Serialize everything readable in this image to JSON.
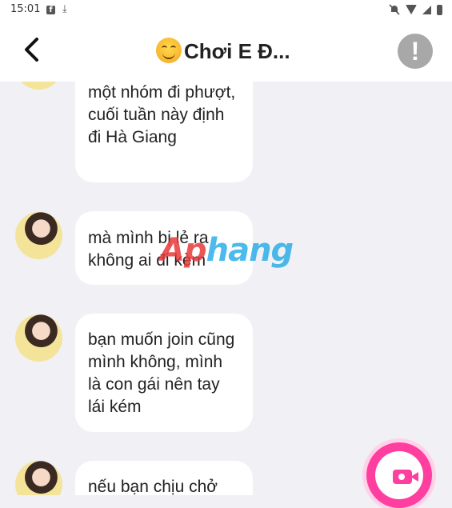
{
  "status_bar": {
    "time": "15:01",
    "icons": [
      "facebook-notification-icon",
      "download-icon",
      "mute-icon",
      "wifi-icon",
      "signal-icon",
      "battery-icon"
    ]
  },
  "header": {
    "title": "Chơi E Đ...",
    "title_emoji": "smiling-face-emoji",
    "back_icon": "chevron-left-icon",
    "report_icon": "exclamation-circle-icon"
  },
  "messages": [
    {
      "text": "một nhóm đi phượt, cuối tuần này định đi Hà Giang"
    },
    {
      "text": "mà mình bị lẻ ra không ai đi kèm"
    },
    {
      "text": "bạn muốn join cũng mình không, mình là con gái nên tay lái kém"
    },
    {
      "text": "nếu bạn chịu chở"
    }
  ],
  "watermark": {
    "part1": "Ap",
    "part2": "hang"
  },
  "video_call_button": {
    "icon": "video-camera-icon"
  },
  "colors": {
    "background": "#f0f0f5",
    "bubble": "#ffffff",
    "accent_pink": "#ff3fa0",
    "report_gray": "#a8a8a8"
  }
}
